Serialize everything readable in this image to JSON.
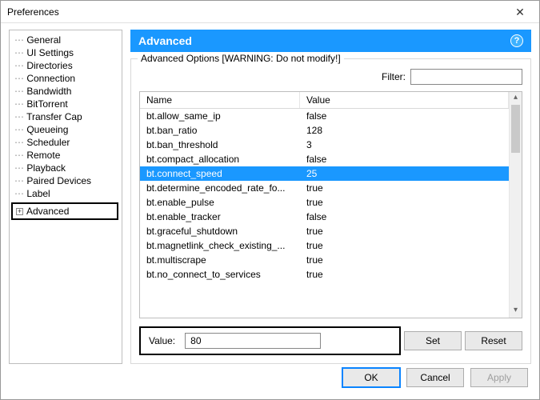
{
  "window": {
    "title": "Preferences"
  },
  "sidebar": {
    "items": [
      "General",
      "UI Settings",
      "Directories",
      "Connection",
      "Bandwidth",
      "BitTorrent",
      "Transfer Cap",
      "Queueing",
      "Scheduler",
      "Remote",
      "Playback",
      "Paired Devices",
      "Label"
    ],
    "advanced": "Advanced"
  },
  "content": {
    "header": "Advanced",
    "groupbox_title": "Advanced Options [WARNING: Do not modify!]",
    "filter_label": "Filter:",
    "filter_value": "",
    "columns": {
      "name": "Name",
      "value": "Value"
    },
    "rows": [
      {
        "name": "bt.allow_same_ip",
        "value": "false",
        "selected": false
      },
      {
        "name": "bt.ban_ratio",
        "value": "128",
        "selected": false
      },
      {
        "name": "bt.ban_threshold",
        "value": "3",
        "selected": false
      },
      {
        "name": "bt.compact_allocation",
        "value": "false",
        "selected": false
      },
      {
        "name": "bt.connect_speed",
        "value": "25",
        "selected": true
      },
      {
        "name": "bt.determine_encoded_rate_fo...",
        "value": "true",
        "selected": false
      },
      {
        "name": "bt.enable_pulse",
        "value": "true",
        "selected": false
      },
      {
        "name": "bt.enable_tracker",
        "value": "false",
        "selected": false
      },
      {
        "name": "bt.graceful_shutdown",
        "value": "true",
        "selected": false
      },
      {
        "name": "bt.magnetlink_check_existing_...",
        "value": "true",
        "selected": false
      },
      {
        "name": "bt.multiscrape",
        "value": "true",
        "selected": false
      },
      {
        "name": "bt.no_connect_to_services",
        "value": "true",
        "selected": false
      }
    ],
    "value_label": "Value:",
    "value_input": "80",
    "set_label": "Set",
    "reset_label": "Reset"
  },
  "footer": {
    "ok": "OK",
    "cancel": "Cancel",
    "apply": "Apply"
  }
}
